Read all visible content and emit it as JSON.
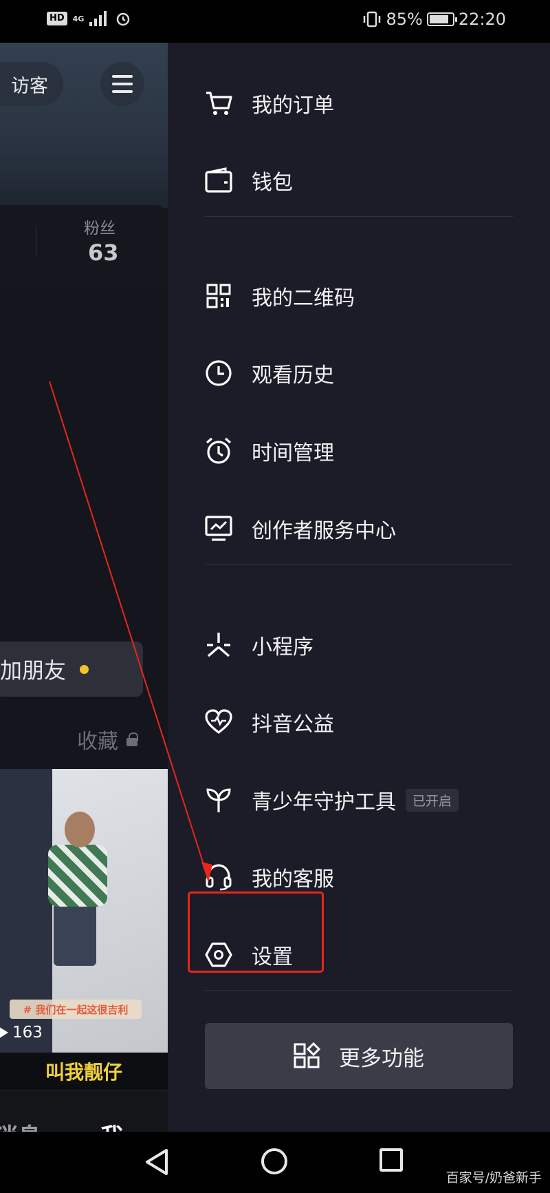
{
  "status_bar": {
    "hd": "HD",
    "network": "4G",
    "battery_percent": "85%",
    "battery_level": 0.85,
    "time": "22:20"
  },
  "profile": {
    "visitor_label": "访客",
    "fans_label": "粉丝",
    "fans_count": "63",
    "add_friend_label": "加朋友",
    "favorites_label": "收藏",
    "video_caption": "# 我们在一起这很吉利",
    "video_plays": "163",
    "banner_text": "叫我靓仔",
    "tab_message": "消息",
    "tab_me": "我"
  },
  "drawer": {
    "items": [
      {
        "label": "我的订单",
        "icon": "cart-icon"
      },
      {
        "label": "钱包",
        "icon": "wallet-icon"
      },
      {
        "label": "我的二维码",
        "icon": "qrcode-icon"
      },
      {
        "label": "观看历史",
        "icon": "clock-icon"
      },
      {
        "label": "时间管理",
        "icon": "alarm-icon"
      },
      {
        "label": "创作者服务中心",
        "icon": "monitor-chart-icon"
      },
      {
        "label": "小程序",
        "icon": "mini-program-icon"
      },
      {
        "label": "抖音公益",
        "icon": "heart-icon"
      },
      {
        "label": "青少年守护工具",
        "icon": "sprout-icon",
        "tag": "已开启"
      },
      {
        "label": "我的客服",
        "icon": "headset-icon"
      },
      {
        "label": "设置",
        "icon": "settings-hexagon-icon"
      }
    ],
    "more_label": "更多功能"
  },
  "watermark": "百家号/奶爸新手",
  "colors": {
    "drawer_bg": "#1b1c27",
    "annotation_red": "#e8261d",
    "accent_yellow": "#f1c428"
  }
}
